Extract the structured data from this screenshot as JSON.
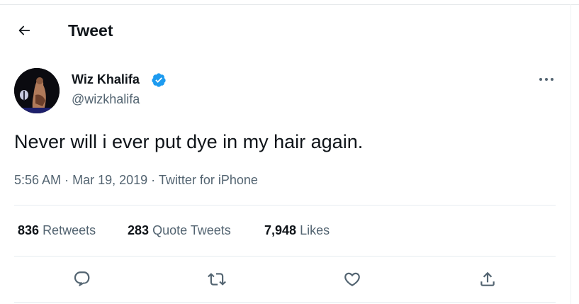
{
  "header": {
    "title": "Tweet",
    "back_icon": "arrow-left-icon"
  },
  "author": {
    "name": "Wiz Khalifa",
    "handle": "@wizkhalifa",
    "verified": true,
    "verified_color": "#1d9bf0"
  },
  "tweet": {
    "text": "Never will i ever put dye in my hair again."
  },
  "meta": {
    "time": "5:56 AM",
    "separator": "·",
    "date": "Mar 19, 2019",
    "source": "Twitter for iPhone"
  },
  "stats": [
    {
      "count": "836",
      "label": "Retweets"
    },
    {
      "count": "283",
      "label": "Quote Tweets"
    },
    {
      "count": "7,948",
      "label": "Likes"
    }
  ],
  "actions": [
    "reply-icon",
    "retweet-icon",
    "like-icon",
    "share-icon"
  ],
  "colors": {
    "text": "#0f1419",
    "secondary": "#536471",
    "divider": "#e6ecf0",
    "icon": "#536471"
  }
}
